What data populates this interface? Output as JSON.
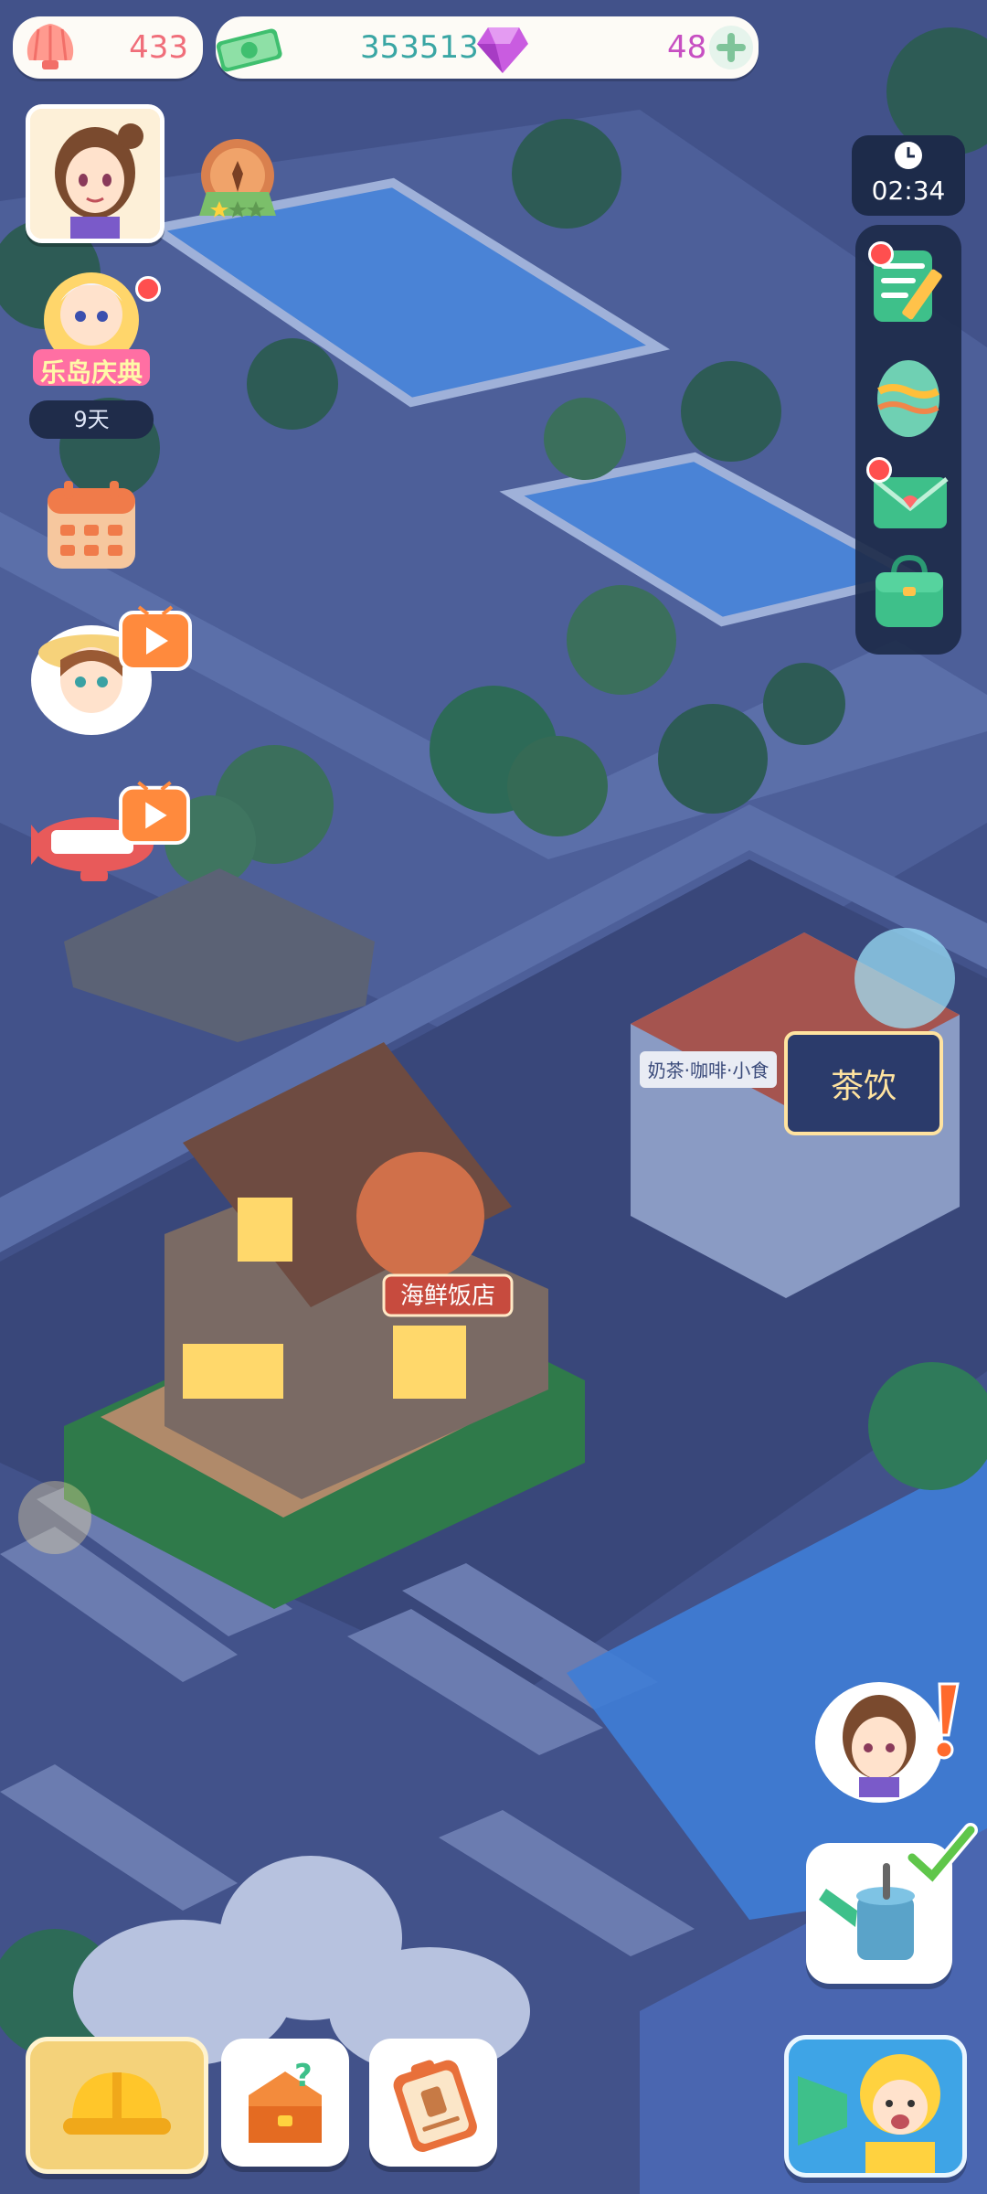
{
  "hud": {
    "shells": "433",
    "cash": "353513",
    "gems": "48",
    "timer": "02:34",
    "event_label": "乐岛庆典",
    "event_days": "9天"
  },
  "signs": {
    "seafood": "海鲜饭店",
    "cafe_left": "奶茶·咖啡·小食",
    "cafe_main": "茶饮"
  },
  "colors": {
    "shells_text": "#f06e7a",
    "cash_text": "#3aa6a4",
    "gems_text": "#c74fc2",
    "timer_bg": "#1d2b4a",
    "accent_yellow": "#f7c948"
  }
}
